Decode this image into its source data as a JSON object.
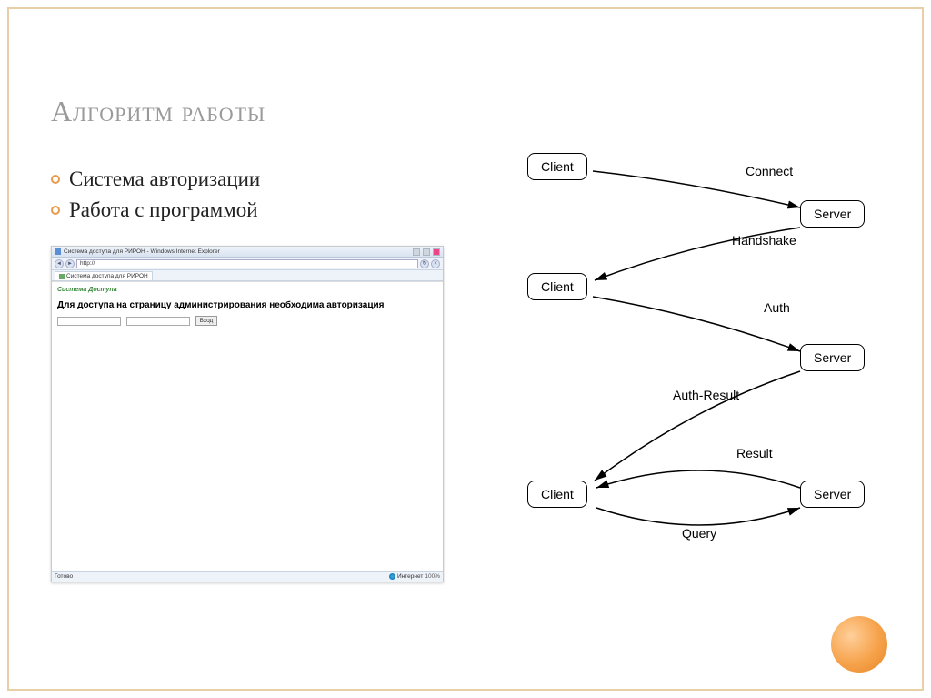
{
  "slide": {
    "title": "Алгоритм работы",
    "bullets": [
      "Система авторизации",
      "Работа с программой"
    ]
  },
  "browser": {
    "window_title": "Система доступа для РИРОН - Windows Internet Explorer",
    "url": "http://",
    "tab_label": "Система доступа для РИРОН",
    "green_header": "Система Доступа",
    "auth_message": "Для доступа на страницу администрирования необходима авторизация",
    "login_button": "Вход",
    "status_done": "Готово",
    "status_mode": "Интернет",
    "zoom": "100%"
  },
  "diagram": {
    "nodes": {
      "client1": "Client",
      "server1": "Server",
      "client2": "Client",
      "server2": "Server",
      "client3": "Client",
      "server3": "Server"
    },
    "edges": {
      "connect": "Connect",
      "handshake": "Handshake",
      "auth": "Auth",
      "auth_result": "Auth-Result",
      "result": "Result",
      "query": "Query"
    }
  }
}
